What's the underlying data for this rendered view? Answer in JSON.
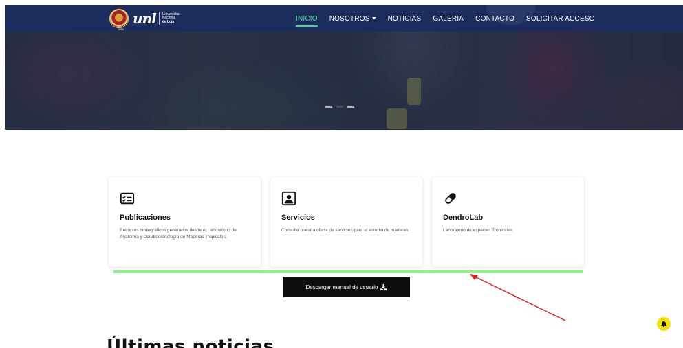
{
  "nav": {
    "logo": {
      "brand": "unl",
      "line1": "Universidad",
      "line2": "Nacional",
      "line3": "de Loja",
      "year": "1859"
    },
    "items": [
      {
        "label": "INICIO",
        "active": true
      },
      {
        "label": "NOSOTROS",
        "dropdown": true
      },
      {
        "label": "NOTICIAS"
      },
      {
        "label": "GALERIA"
      },
      {
        "label": "CONTACTO"
      },
      {
        "label": "SOLICITAR ACCESO"
      }
    ]
  },
  "carousel": {
    "indicator_count": 3,
    "active_index": 1
  },
  "cards": [
    {
      "title": "Publicaciones",
      "icon": "list-card-icon",
      "text": "Recursos bibliográficos generados desde el Laboratorio de Anatomía y Dendrocronología de Maderas Tropicales."
    },
    {
      "title": "Servicios",
      "icon": "user-portrait-icon",
      "text": "Consulte nuestra oferta de servicios para el estudio de maderas."
    },
    {
      "title": "DendroLab",
      "icon": "capsule-icon",
      "text": "Laboratorio de especies Tropicales"
    }
  ],
  "download": {
    "label": "Descargar manual de usuario",
    "icon": "download-icon"
  },
  "section_heading_partial": "Últimas noticias",
  "colors": {
    "nav_bg": "#1b2d5f",
    "active": "#3ddc84",
    "green_line": "#8ef28a",
    "arrow": "#e81e1e",
    "notif": "#f2e10b"
  }
}
